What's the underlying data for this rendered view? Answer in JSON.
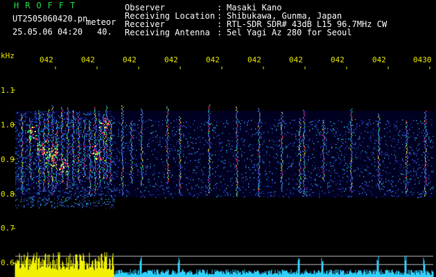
{
  "brand": "HROFFT",
  "filename": "UT2505060420.pn",
  "meteor_label": "meteor",
  "datetime": "25.05.06 04:20",
  "count": "40.",
  "meta": [
    {
      "label": "Observer",
      "sep": ":",
      "value": "Masaki Kano"
    },
    {
      "label": "Receiving Location",
      "sep": ":",
      "value": "Shibukawa, Gunma, Japan"
    },
    {
      "label": "Receiver",
      "sep": ":",
      "value": "RTL-SDR SDR# 43dB L15 96.7MHz CW"
    },
    {
      "label": "Receiving Antenna",
      "sep": ":",
      "value": "5el Yagi Az 280 for Seoul"
    }
  ],
  "yaxis_unit": "kHz",
  "yticks": [
    "1.1",
    "1.0",
    "0.9",
    "0.8",
    "0.7",
    "0.6"
  ],
  "xticks": [
    "042",
    "042",
    "042",
    "042",
    "042",
    "042",
    "042",
    "042",
    "042",
    "0430"
  ],
  "colors": {
    "text_green": "#22dd44",
    "text_yellow": "#e8e800",
    "background": "#000000"
  }
}
